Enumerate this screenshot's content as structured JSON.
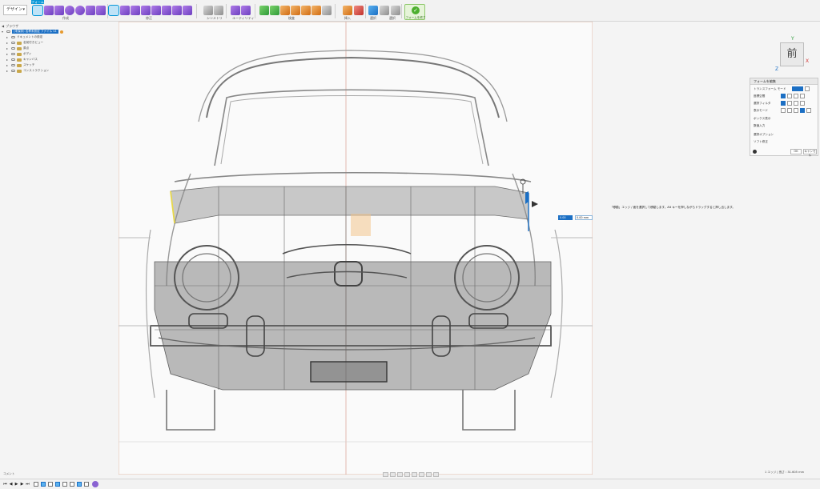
{
  "toolbar": {
    "workspace_label": "デザイン",
    "active_tab": "フォーム",
    "groups": {
      "create": "作成",
      "modify": "修正",
      "symmetry": "シンメトリ",
      "utility": "ユーティリティ",
      "inspect": "検査",
      "insert": "挿入",
      "select": "選択",
      "finish_form": "フォームを終了"
    }
  },
  "browser": {
    "title": "ブラウザ",
    "items": [
      {
        "label": "(未保存) 名称未設定 ファイル v1",
        "kind": "root"
      },
      {
        "label": "ドキュメントの設定",
        "kind": "settings"
      },
      {
        "label": "名前付きビュー",
        "kind": "folder"
      },
      {
        "label": "原点",
        "kind": "folder"
      },
      {
        "label": "ボディ",
        "kind": "folder"
      },
      {
        "label": "キャンバス",
        "kind": "folder"
      },
      {
        "label": "スケッチ",
        "kind": "folder"
      },
      {
        "label": "コンストラクション",
        "kind": "folder"
      }
    ]
  },
  "viewcube": {
    "face": "前",
    "axes": {
      "y": "Y",
      "x": "X",
      "z": "Z"
    }
  },
  "panel": {
    "title": "フォームを編集",
    "rows": {
      "transform_mode": "トランスフォーム モード",
      "coord_space": "座標空間",
      "selection_filter": "選択フィルタ",
      "display_mode": "表示モード",
      "selection_options": "選択オプション",
      "soft_modification": "ソフト修正",
      "transform_value": "ボックス表示",
      "numeric_input": "数値入力"
    },
    "ok": "OK",
    "cancel": "キャンセル"
  },
  "hint": "「移動」エッジ / 面を選択して移動します。Alt キーを押しながらドラッグすると押し出します。",
  "dim_inputs": [
    "0.00 mm",
    "0.00 mm"
  ],
  "status": {
    "right": "1 エッジ | 長さ : 31.605 mm"
  },
  "comment_label": "コメント",
  "colors": {
    "accent": "#0696d7",
    "selection_blue": "#1b6fc4",
    "finish_green": "#4caf2e",
    "tool_purple": "#8a63d2"
  }
}
